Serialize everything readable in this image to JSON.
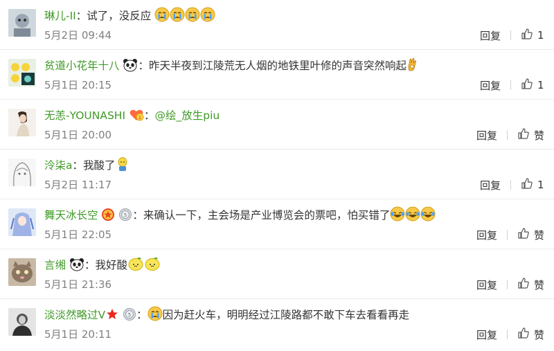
{
  "comments": [
    {
      "username": "琳儿-II",
      "colon": "：",
      "text": "试了，没反应",
      "date": "5月2日 09:44",
      "reply": "回复",
      "likes": "1",
      "emojis_after": [
        "crying-emoji",
        "crying-emoji",
        "crying-emoji",
        "crying-emoji"
      ]
    },
    {
      "username": "贫道小花年十八",
      "colon": "：",
      "text": "昨天半夜到江陵荒无人烟的地铁里叶修的声音突然响起",
      "date": "5月1日 20:15",
      "reply": "回复",
      "likes": "1",
      "badge_after_name": "panda-badge",
      "emojis_after": [
        "ok-hand-emoji"
      ]
    },
    {
      "username": "无恙-YOUNASHI",
      "colon": "：",
      "mention": "@绘_放生piu",
      "date": "5月1日 20:00",
      "reply": "回复",
      "likes": "赞",
      "badge_after_name": "heart-badge"
    },
    {
      "username": "泠柒a",
      "colon": "：",
      "text": "我酸了",
      "date": "5月2日 11:17",
      "reply": "回复",
      "likes": "1",
      "emojis_after": [
        "lemon-person-emoji"
      ]
    },
    {
      "username": "舞天冰长空",
      "colon": "：",
      "text": "来确认一下，主会场是产业博览会的票吧，怕买错了",
      "date": "5月1日 22:05",
      "reply": "回复",
      "likes": "赞",
      "badges_after_name": [
        "star-badge",
        "medal-badge"
      ],
      "emojis_after": [
        "laugh-cry-emoji",
        "laugh-cry-emoji",
        "laugh-cry-emoji"
      ]
    },
    {
      "username": "言缃",
      "colon": "：",
      "text": "我好酸",
      "date": "5月1日 21:36",
      "reply": "回复",
      "likes": "赞",
      "badge_after_name": "panda-badge",
      "emojis_after": [
        "lemon-emoji",
        "lemon-emoji"
      ]
    },
    {
      "username": "淡淡然略过V",
      "colon": "：",
      "text": "因为赶火车，明明经过江陵路都不敢下车去看看再走",
      "date": "5月1日 20:11",
      "reply": "回复",
      "likes": "赞",
      "badges_after_name": [
        "red-star-badge",
        "medal-badge"
      ],
      "emojis_before_text": [
        "crying-emoji"
      ]
    }
  ],
  "colors": {
    "username": "#3f9a26",
    "meta": "#808080",
    "text": "#333333"
  }
}
